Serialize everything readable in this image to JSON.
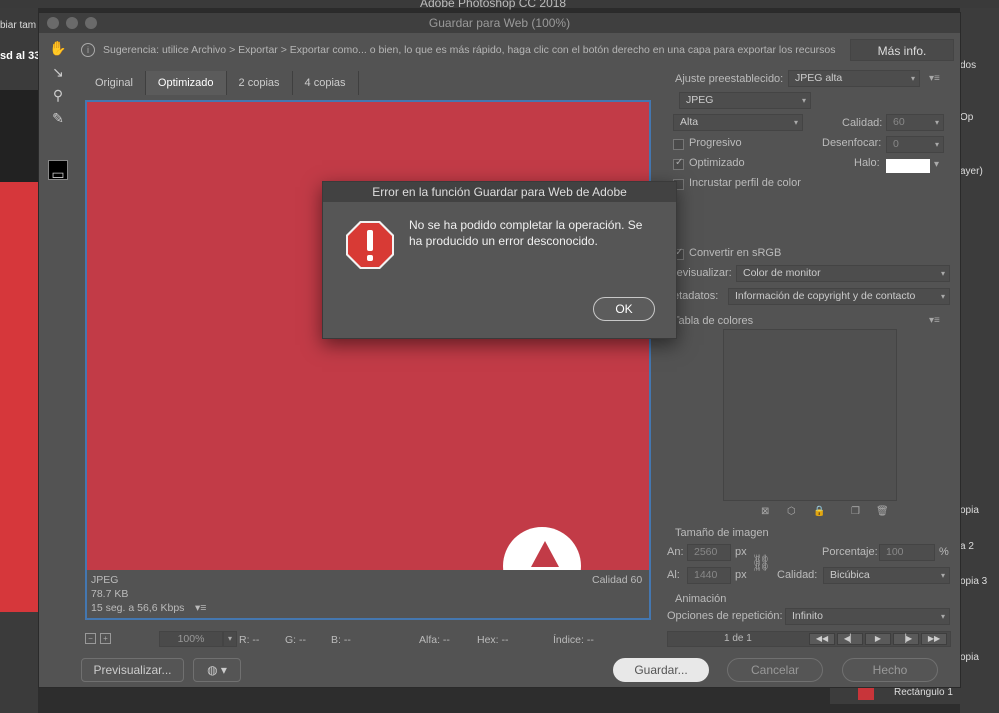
{
  "app": {
    "title": "Adobe Photoshop CC 2018"
  },
  "background": {
    "left_text_1": "biar tam",
    "left_text_2": "sd al 33",
    "right_labels": [
      "dos",
      "Op",
      "ayer)",
      "opia",
      "a 2",
      "opia 3",
      "opia"
    ],
    "layer_name": "Rectángulo 1",
    "layer_color": "#c8353a"
  },
  "window": {
    "title": "Guardar para Web (100%)",
    "hint": "Sugerencia: utilice Archivo > Exportar > Exportar como... o bien, lo que es más rápido, haga clic con el botón derecho en una capa para exportar los recursos",
    "mas_info": "Más info.",
    "tabs": [
      "Original",
      "Optimizado",
      "2 copias",
      "4 copias"
    ],
    "active_tab": "Optimizado",
    "preview": {
      "format": "JPEG",
      "size": "78.7 KB",
      "time": "15 seg. a 56,6 Kbps",
      "quality": "Calidad 60",
      "bg_color": "#c23b47"
    },
    "status": {
      "zoom": "100%",
      "r": "R: --",
      "g": "G: --",
      "b": "B: --",
      "alfa": "Alfa: --",
      "hex": "Hex: --",
      "indice": "Índice: --"
    },
    "buttons": {
      "previsualizar": "Previsualizar...",
      "guardar": "Guardar...",
      "cancelar": "Cancelar",
      "hecho": "Hecho"
    },
    "settings": {
      "preset_label": "Ajuste preestablecido:",
      "preset_value": "JPEG alta",
      "format_value": "JPEG",
      "compression_value": "Alta",
      "calidad_label": "Calidad:",
      "calidad_value": "60",
      "progresivo": "Progresivo",
      "desenfocar_label": "Desenfocar:",
      "desenfocar_value": "0",
      "optimizado": "Optimizado",
      "halo_label": "Halo:",
      "incrustar": "Incrustar perfil de color",
      "convertir": "Convertir en sRGB",
      "previsualizar_label": "revisualizar:",
      "previsualizar_value": "Color de monitor",
      "metadatos_label": "etadatos:",
      "metadatos_value": "Información de copyright y de contacto",
      "tabla_colores": "Tabla de colores",
      "tamano_imagen": "Tamaño de imagen",
      "an_label": "An:",
      "an_value": "2560",
      "al_label": "Al:",
      "al_value": "1440",
      "px": "px",
      "porcentaje_label": "Porcentaje:",
      "porcentaje_value": "100",
      "percent": "%",
      "calidad2_label": "Calidad:",
      "calidad2_value": "Bicúbica",
      "animacion": "Animación",
      "repeticion_label": "Opciones de repetición:",
      "repeticion_value": "Infinito",
      "frame": "1 de 1"
    }
  },
  "dialog": {
    "title": "Error en la función Guardar para Web de Adobe",
    "message": "No se ha podido completar la operación. Se ha producido un error desconocido.",
    "ok": "OK",
    "icon_color": "#d83a35"
  }
}
